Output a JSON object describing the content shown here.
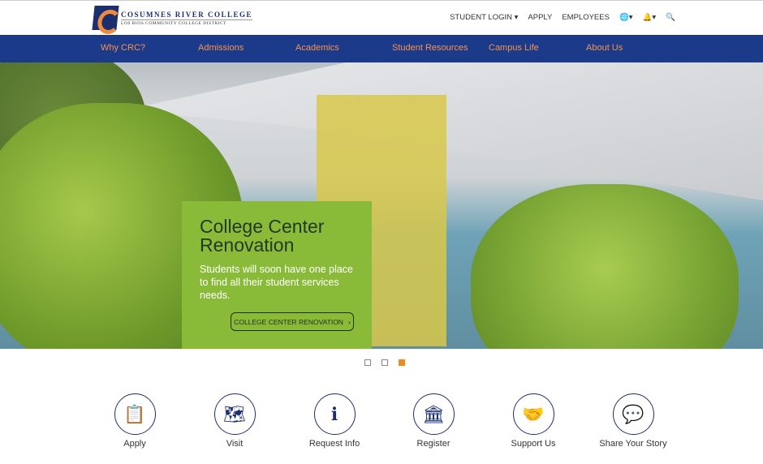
{
  "header": {
    "logo_name": "COSUMNES RIVER COLLEGE",
    "logo_sub": "LOS RIOS COMMUNITY COLLEGE DISTRICT",
    "utility": [
      {
        "label": "STUDENT LOGIN ▾"
      },
      {
        "label": "APPLY"
      },
      {
        "label": "EMPLOYEES"
      },
      {
        "label": "🌐▾"
      },
      {
        "label": "🔔▾"
      },
      {
        "label": "🔍"
      }
    ]
  },
  "nav": [
    "Why CRC?",
    "Admissions",
    "Academics",
    "Student Resources",
    "Campus Life",
    "About Us"
  ],
  "hero": {
    "title": "College Center Renovation",
    "text": "Students will soon have one place to find all their student services needs.",
    "button": "COLLEGE CENTER RENOVATION",
    "button_icon": "›",
    "slides": 3,
    "active_slide": 3
  },
  "quick_links": [
    {
      "label": "Apply",
      "icon": "📋"
    },
    {
      "label": "Visit",
      "icon": "🗺"
    },
    {
      "label": "Request Info",
      "icon": "ℹ"
    },
    {
      "label": "Register",
      "icon": "🏛"
    },
    {
      "label": "Support Us",
      "icon": "🤝"
    },
    {
      "label": "Share Your Story",
      "icon": "💬"
    }
  ],
  "colors": {
    "nav_bg": "#1b3a8a",
    "nav_text": "#f59350",
    "card": "#8abb38",
    "accent": "#f08a1c"
  }
}
